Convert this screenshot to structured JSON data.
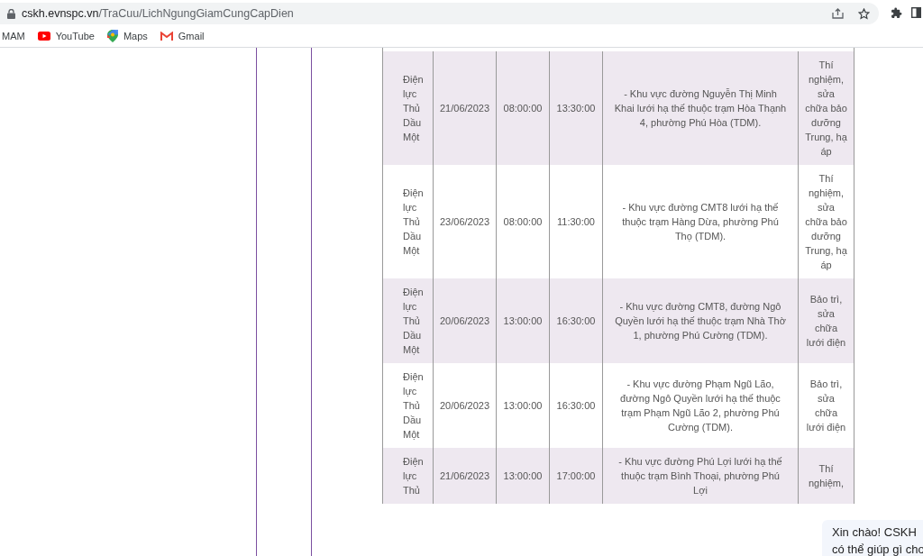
{
  "address_bar": {
    "host": "cskh.evnspc.vn",
    "path": "/TraCuu/LichNgungGiamCungCapDien"
  },
  "bookmarks": [
    {
      "label": "MAM",
      "kind": "plain"
    },
    {
      "label": "YouTube",
      "kind": "youtube"
    },
    {
      "label": "Maps",
      "kind": "maps"
    },
    {
      "label": "Gmail",
      "kind": "gmail"
    }
  ],
  "table": {
    "rows": [
      {
        "unit": "Điện lực Thủ Dầu Một",
        "date": "21/06/2023",
        "start": "08:00:00",
        "end": "13:30:00",
        "area": "- Khu vực đường Nguyễn Thị Minh Khai lưới hạ thế thuộc trạm Hòa Thạnh 4, phường Phú Hòa (TDM).",
        "reason": "Thí nghiệm, sửa chữa bảo dưỡng Trung, hạ áp",
        "shaded": true
      },
      {
        "unit": "Điện lực Thủ Dầu Một",
        "date": "23/06/2023",
        "start": "08:00:00",
        "end": "11:30:00",
        "area": "- Khu vực đường CMT8 lưới hạ thế thuộc trạm Hàng Dừa, phường Phú Thọ (TDM).",
        "reason": "Thí nghiệm, sửa chữa bảo dưỡng Trung, hạ áp",
        "shaded": false
      },
      {
        "unit": "Điện lực Thủ Dầu Một",
        "date": "20/06/2023",
        "start": "13:00:00",
        "end": "16:30:00",
        "area": "- Khu vực đường CMT8, đường Ngô Quyền lưới hạ thế thuộc trạm Nhà Thờ 1, phường Phú Cường (TDM).",
        "reason": "Bảo trì, sửa chữa lưới điện",
        "shaded": true
      },
      {
        "unit": "Điện lực Thủ Dầu Một",
        "date": "20/06/2023",
        "start": "13:00:00",
        "end": "16:30:00",
        "area": "- Khu vực đường Phạm Ngũ Lão, đường Ngô Quyền lưới hạ thế thuộc trạm Phạm Ngũ Lão 2, phường Phú Cường (TDM).",
        "reason": "Bảo trì, sửa chữa lưới điện",
        "shaded": false
      },
      {
        "unit": "Điện lực Thủ",
        "date": "21/06/2023",
        "start": "13:00:00",
        "end": "17:00:00",
        "area": "- Khu vực đường Phú Lợi lưới hạ thế thuộc trạm Bình Thoại, phường Phú Lợi",
        "reason": "Thí nghiệm,",
        "shaded": true
      }
    ]
  },
  "chat_bubble": {
    "lines": [
      "Xin chào! CSKH",
      "có thể giúp gì cho"
    ]
  }
}
